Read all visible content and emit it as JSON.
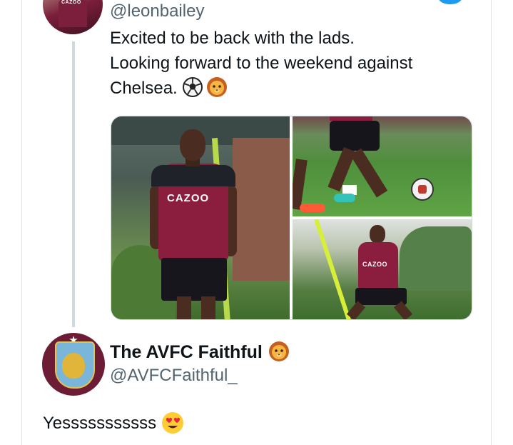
{
  "quoted_tweet": {
    "handle": "@leonbailey",
    "lines": [
      "Excited to be back with the lads.",
      "Looking forward to the weekend against",
      "Chelsea."
    ],
    "emojis": [
      "soccer-ball-icon",
      "lion-face-icon"
    ],
    "avatar_text": "CAZOO",
    "media": {
      "photo_left_sponsor": "CAZOO",
      "photo_bottom_right_sponsor": "CAZOO"
    }
  },
  "reply": {
    "display_name": "The AVFC Faithful",
    "name_emoji": "lion-face-icon",
    "handle": "@AVFCFaithful_",
    "text": "Yesssssssssss",
    "text_emoji": "heart-eyes-face-icon"
  },
  "colors": {
    "link_blue": "#1d9bf0",
    "villa_claret": "#8b1e3f",
    "secondary_text": "#536471",
    "thread_line": "#cfd9de"
  }
}
